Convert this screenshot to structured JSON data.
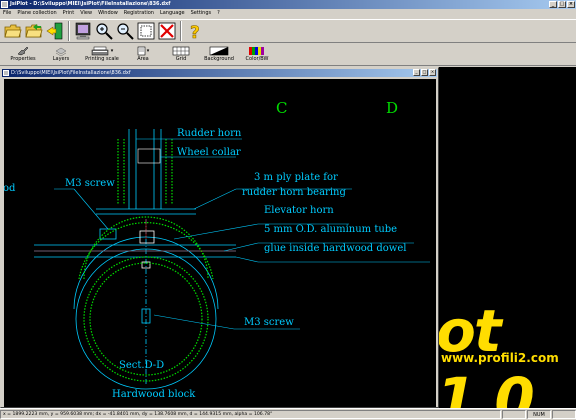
{
  "window": {
    "title": "JsiPlot - D:\\Sviluppo\\MIEI\\JsiPlot\\FileInstallazione\\836.dxf",
    "minimize": "_",
    "maximize": "□",
    "close": "×"
  },
  "menu": [
    "File",
    "Plane collection",
    "Print",
    "View",
    "Window",
    "Registration",
    "Language",
    "Settings",
    "?"
  ],
  "toolbar2": {
    "properties": "Properties",
    "layers": "Layers",
    "printing_scale": "Printing scale",
    "area": "Area",
    "grid": "Grid",
    "background": "Background",
    "color_bw": "Color/BW"
  },
  "child_window": {
    "title": "D:\\Sviluppo\\MIEI\\JsiPlot\\FileInstallazione\\836.dxf"
  },
  "drawing": {
    "label_c": "C",
    "label_d": "D",
    "rudder_horn": "Rudder horn",
    "wheel_collar": "Wheel collar",
    "m3_screw_top": "M3 screw",
    "ply_plate_1": "3 m ply plate for",
    "ply_plate_2": "rudder horn bearing",
    "elevator_horn": "Elevator horn",
    "aluminum_tube": "5 mm O.D. aluminum tube",
    "glue_dowel": "glue inside hardwood dowel",
    "m3_screw_bottom": "M3 screw",
    "sect": "Sect.D-D",
    "hardwood_block": "Hardwood block",
    "left_partial": "od"
  },
  "background_logo": {
    "text": "ot 1.0",
    "url": "www.profili2.com"
  },
  "status": {
    "coords": "x = 1899.2223 mm, y = 959.6038 mm; dx = -41.8401 mm, dy = 138.7608 mm, d = 144.9315 mm, alpha = 106.78°",
    "cell1": "",
    "cell2": "NUM",
    "cell3": ""
  },
  "colors": {
    "drawing_lines": "#00ccff",
    "drawing_green": "#00dd00",
    "logo_yellow": "#ffdd00"
  }
}
